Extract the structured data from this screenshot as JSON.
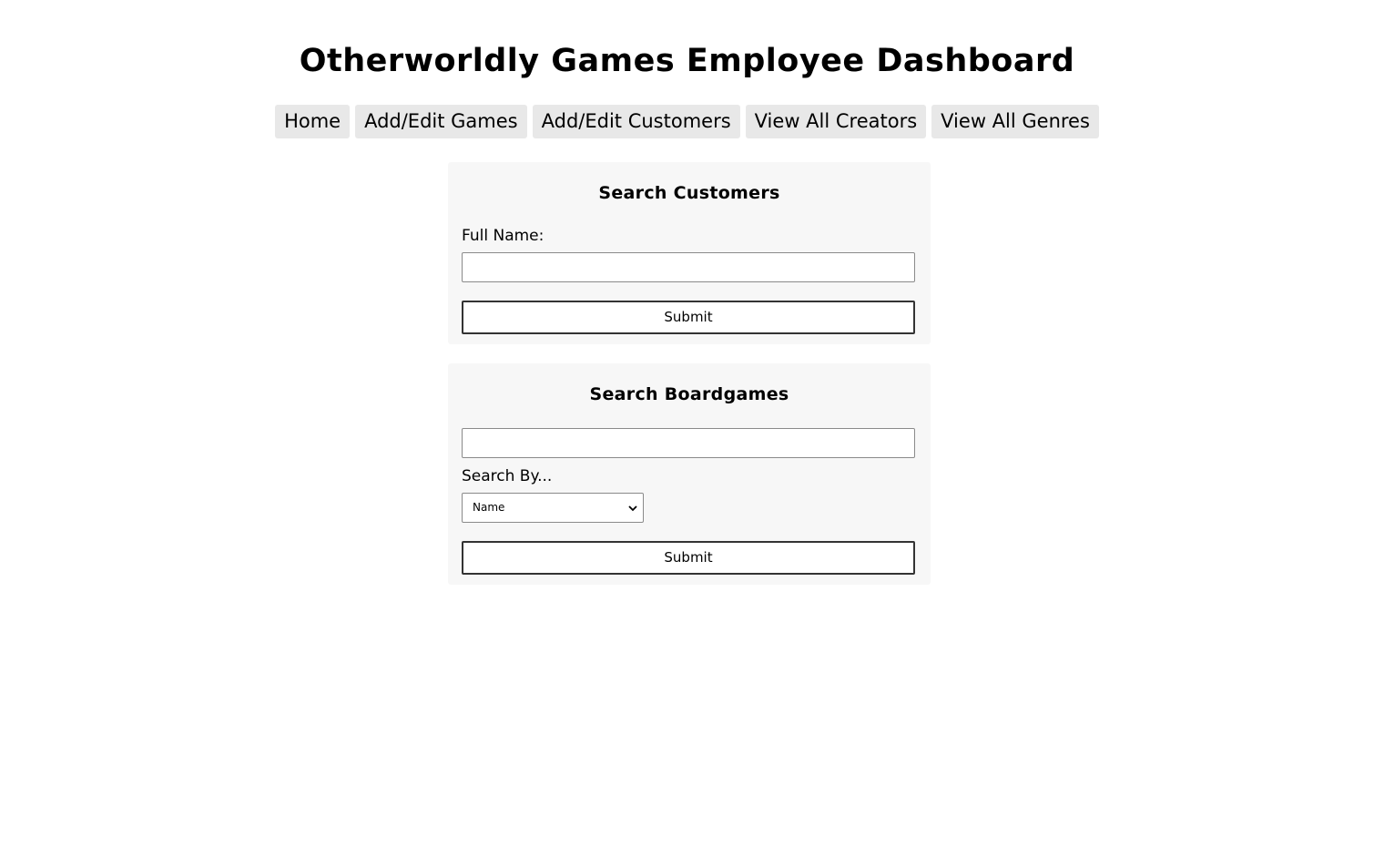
{
  "header": {
    "title": "Otherworldly Games Employee Dashboard"
  },
  "nav": {
    "items": [
      {
        "label": "Home"
      },
      {
        "label": "Add/Edit Games"
      },
      {
        "label": "Add/Edit Customers"
      },
      {
        "label": "View All Creators"
      },
      {
        "label": "View All Genres"
      }
    ]
  },
  "search_customers": {
    "title": "Search Customers",
    "full_name_label": "Full Name:",
    "full_name_value": "",
    "submit_label": "Submit"
  },
  "search_boardgames": {
    "title": "Search Boardgames",
    "query_value": "",
    "search_by_label": "Search By...",
    "search_by_selected": "Name",
    "submit_label": "Submit"
  },
  "colors": {
    "nav_button_bg": "#e8e8e8",
    "panel_bg": "#f7f7f7"
  }
}
